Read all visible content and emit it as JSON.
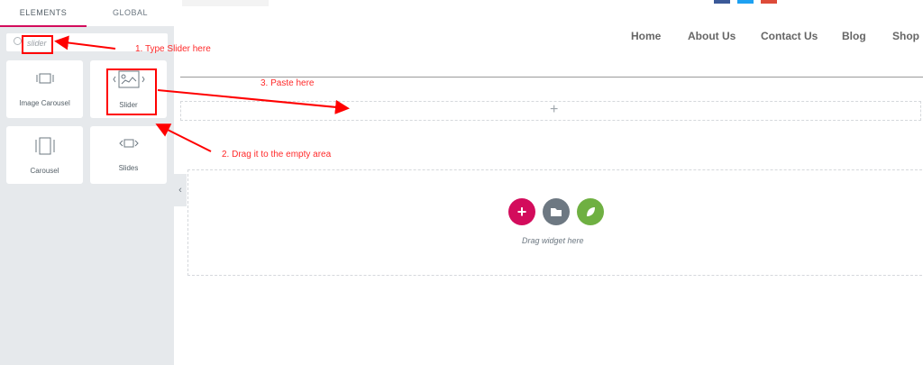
{
  "sidebar": {
    "tabs": [
      {
        "label": "ELEMENTS"
      },
      {
        "label": "GLOBAL"
      }
    ],
    "search": {
      "value": "slider"
    },
    "widgets": [
      {
        "label": "Image Carousel",
        "icon": "image-carousel-icon"
      },
      {
        "label": "Slider",
        "icon": "slider-icon"
      },
      {
        "label": "Carousel",
        "icon": "carousel-icon"
      },
      {
        "label": "Slides",
        "icon": "slides-icon"
      }
    ],
    "collapse_glyph": "‹"
  },
  "header": {
    "nav": [
      "Home",
      "About Us",
      "Contact Us",
      "Blog",
      "Shop"
    ],
    "social_colors": [
      "#3b5998",
      "#1da1f2",
      "#dd4b39"
    ]
  },
  "canvas": {
    "add_glyph": "+",
    "drop_hint": "Drag widget here",
    "buttons": {
      "add": "+"
    }
  },
  "annotations": {
    "step1": "1. Type Slider here",
    "step2": "2. Drag it to the empty area",
    "step3": "3. Paste here"
  },
  "colors": {
    "accent": "#d30c5c",
    "annotation": "#ff0000",
    "panel_bg": "#e6e9ec",
    "folder_button": "#6d7882",
    "template_button": "#6fb042"
  }
}
